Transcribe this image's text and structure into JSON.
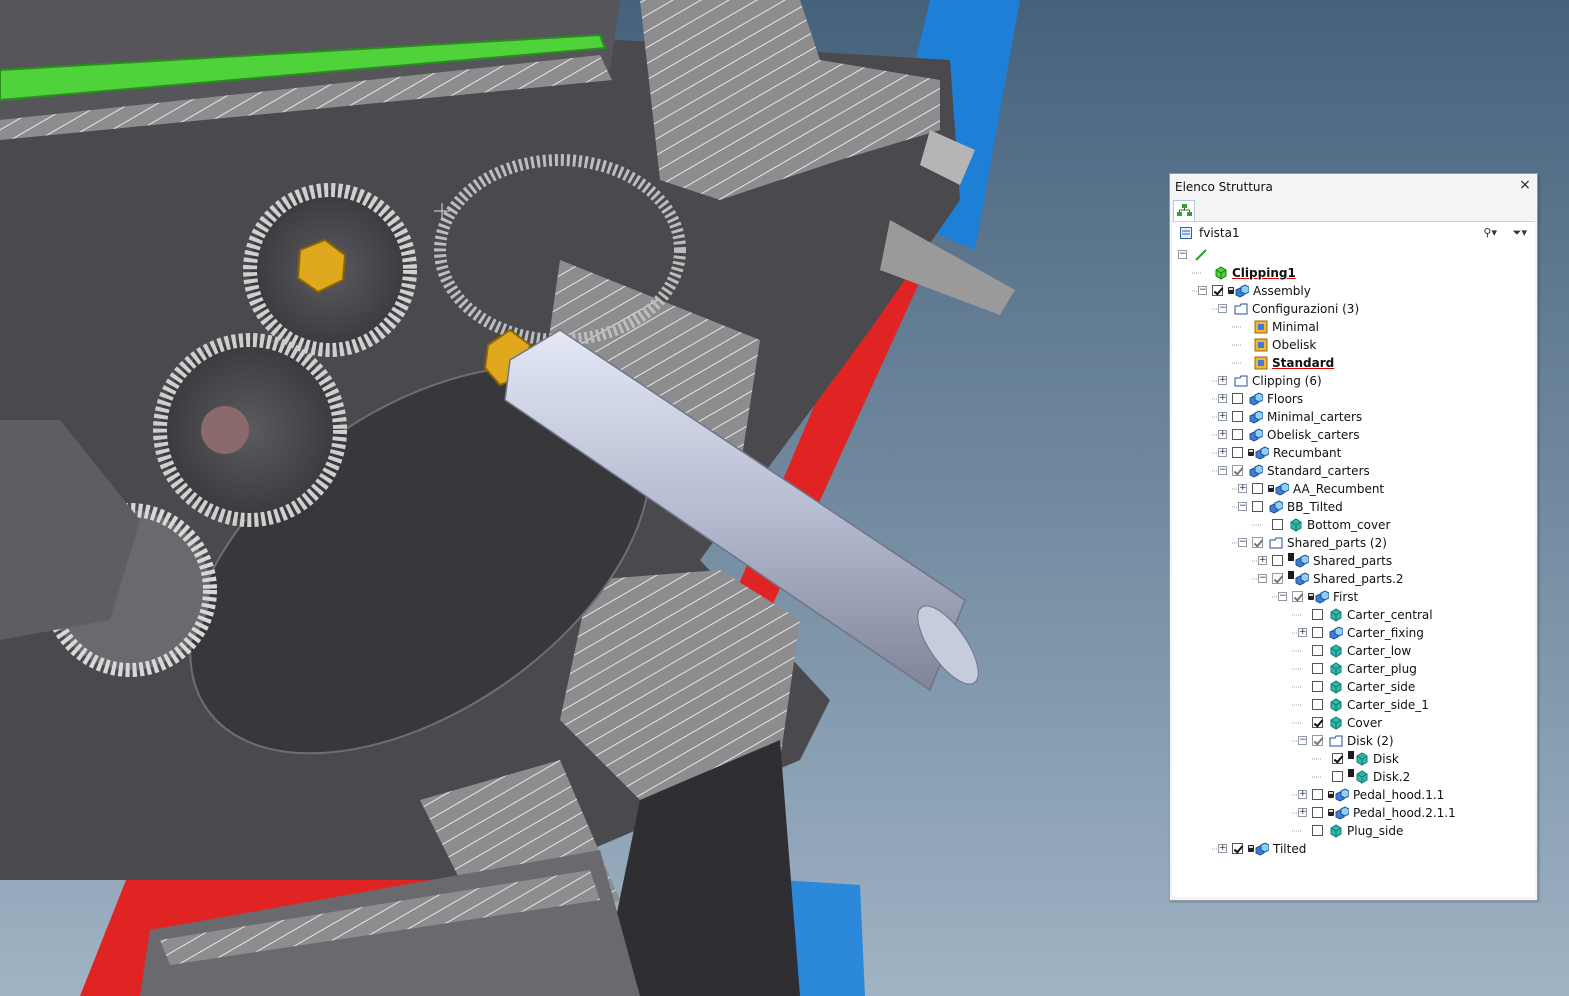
{
  "panel": {
    "title": "Elenco Struttura",
    "close": "×",
    "view_name": "fvista1",
    "toolbar_icons": [
      "binoculars-icon",
      "filter-icon"
    ]
  },
  "tree": [
    {
      "id": "root-line",
      "label": "",
      "depth": 0,
      "expander": "minus",
      "check": null,
      "icon": "green-line-icon"
    },
    {
      "id": "clipping1",
      "label": "Clipping1",
      "depth": 1,
      "expander": null,
      "check": null,
      "icon": "green-cube-icon",
      "bold": true
    },
    {
      "id": "assembly",
      "label": "Assembly",
      "depth": 1,
      "expander": "minus",
      "check": "on",
      "icon": "assembly-icon",
      "disk": true
    },
    {
      "id": "configurazioni",
      "label": "Configurazioni (3)",
      "depth": 2,
      "expander": "minus",
      "check": null,
      "icon": "folder-config-icon"
    },
    {
      "id": "minimal",
      "label": "Minimal",
      "depth": 3,
      "expander": null,
      "check": null,
      "icon": "config-icon"
    },
    {
      "id": "obelisk",
      "label": "Obelisk",
      "depth": 3,
      "expander": null,
      "check": null,
      "icon": "config-icon"
    },
    {
      "id": "standard",
      "label": "Standard",
      "depth": 3,
      "expander": null,
      "check": null,
      "icon": "config-icon",
      "bold": true
    },
    {
      "id": "clipping6",
      "label": "Clipping (6)",
      "depth": 2,
      "expander": "plus",
      "check": null,
      "icon": "folder-green-icon"
    },
    {
      "id": "floors",
      "label": "Floors",
      "depth": 2,
      "expander": "plus",
      "check": "off",
      "icon": "assembly-icon"
    },
    {
      "id": "minimal_carters",
      "label": "Minimal_carters",
      "depth": 2,
      "expander": "plus",
      "check": "off",
      "icon": "assembly-icon"
    },
    {
      "id": "obelisk_carters",
      "label": "Obelisk_carters",
      "depth": 2,
      "expander": "plus",
      "check": "off",
      "icon": "assembly-icon"
    },
    {
      "id": "recumbant",
      "label": "Recumbant",
      "depth": 2,
      "expander": "plus",
      "check": "off",
      "icon": "assembly-icon",
      "disk": true
    },
    {
      "id": "standard_carters",
      "label": "Standard_carters",
      "depth": 2,
      "expander": "minus",
      "check": "gray",
      "icon": "assembly-icon"
    },
    {
      "id": "aa_recumbent",
      "label": "AA_Recumbent",
      "depth": 3,
      "expander": "plus",
      "check": "off",
      "icon": "assembly-icon",
      "disk": true
    },
    {
      "id": "bb_tilted",
      "label": "BB_Tilted",
      "depth": 3,
      "expander": "minus",
      "check": "off",
      "icon": "assembly-icon"
    },
    {
      "id": "bottom_cover",
      "label": "Bottom_cover",
      "depth": 4,
      "expander": null,
      "check": "off",
      "icon": "part-icon"
    },
    {
      "id": "shared_parts_2",
      "label": "Shared_parts (2)",
      "depth": 3,
      "expander": "minus",
      "check": "gray",
      "icon": "folder-assembly-icon"
    },
    {
      "id": "shared_parts",
      "label": "Shared_parts",
      "depth": 4,
      "expander": "plus",
      "check": "off",
      "icon": "assembly-icon",
      "link": true
    },
    {
      "id": "shared_parts2",
      "label": "Shared_parts.2",
      "depth": 4,
      "expander": "minus",
      "check": "gray",
      "icon": "assembly-icon",
      "link": true
    },
    {
      "id": "first",
      "label": "First",
      "depth": 5,
      "expander": "minus",
      "check": "gray",
      "icon": "assembly-icon",
      "disk": true
    },
    {
      "id": "carter_central",
      "label": "Carter_central",
      "depth": 6,
      "expander": null,
      "check": "off",
      "icon": "part-icon"
    },
    {
      "id": "carter_fixing",
      "label": "Carter_fixing",
      "depth": 6,
      "expander": "plus",
      "check": "off",
      "icon": "assembly-icon"
    },
    {
      "id": "carter_low",
      "label": "Carter_low",
      "depth": 6,
      "expander": null,
      "check": "off",
      "icon": "part-icon"
    },
    {
      "id": "carter_plug",
      "label": "Carter_plug",
      "depth": 6,
      "expander": null,
      "check": "off",
      "icon": "part-icon"
    },
    {
      "id": "carter_side",
      "label": "Carter_side",
      "depth": 6,
      "expander": null,
      "check": "off",
      "icon": "part-icon"
    },
    {
      "id": "carter_side_1",
      "label": "Carter_side_1",
      "depth": 6,
      "expander": null,
      "check": "off",
      "icon": "part-icon"
    },
    {
      "id": "cover",
      "label": "Cover",
      "depth": 6,
      "expander": null,
      "check": "on",
      "icon": "part-icon"
    },
    {
      "id": "disk_2",
      "label": "Disk (2)",
      "depth": 6,
      "expander": "minus",
      "check": "gray",
      "icon": "folder-part-icon"
    },
    {
      "id": "disk",
      "label": "Disk",
      "depth": 7,
      "expander": null,
      "check": "on",
      "icon": "part-icon",
      "link": true
    },
    {
      "id": "disk2",
      "label": "Disk.2",
      "depth": 7,
      "expander": null,
      "check": "off",
      "icon": "part-icon",
      "link": true
    },
    {
      "id": "pedal_hood_1_1",
      "label": "Pedal_hood.1.1",
      "depth": 6,
      "expander": "plus",
      "check": "off",
      "icon": "assembly-icon",
      "disk": true
    },
    {
      "id": "pedal_hood_2_1_1",
      "label": "Pedal_hood.2.1.1",
      "depth": 6,
      "expander": "plus",
      "check": "off",
      "icon": "assembly-icon",
      "disk": true
    },
    {
      "id": "plug_side",
      "label": "Plug_side",
      "depth": 6,
      "expander": null,
      "check": "off",
      "icon": "part-icon"
    },
    {
      "id": "tilted",
      "label": "Tilted",
      "depth": 2,
      "expander": "plus",
      "check": "on",
      "icon": "assembly-icon",
      "disk": true
    }
  ],
  "colors": {
    "background_top": "#46627b",
    "background_bottom": "#9fb3c4",
    "accent_red": "#e02424",
    "accent_blue": "#1e7fd6",
    "accent_green": "#4fd23a",
    "model_gray": "#5f5f63",
    "shaft": "#b9bfd3"
  }
}
